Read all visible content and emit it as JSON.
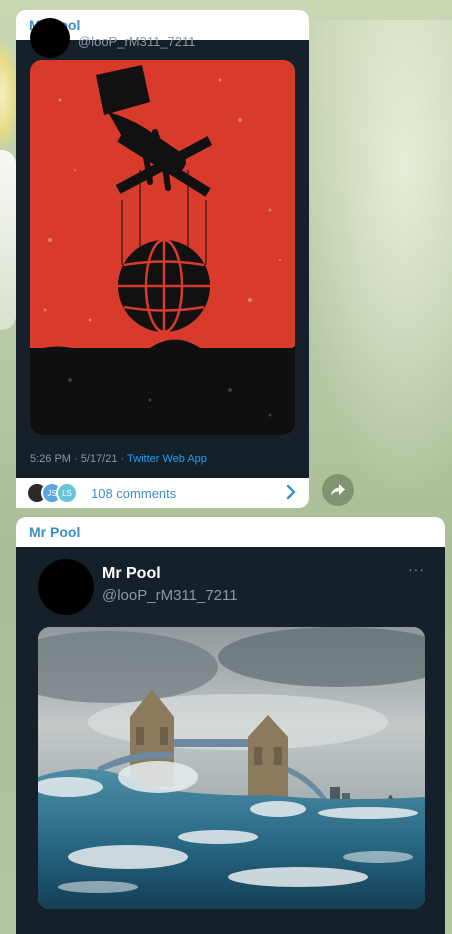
{
  "messages": [
    {
      "sender": "Mr Pool",
      "tweet": {
        "handle": "@looP_rM311_7211",
        "meta_time": "5:26 PM · 5/17/21 · ",
        "meta_app": "Twitter Web App"
      },
      "comments": {
        "avatars": [
          "",
          "JS",
          "LS"
        ],
        "label": "108 comments"
      }
    },
    {
      "sender": "Mr Pool",
      "tweet": {
        "name": "Mr Pool",
        "handle": "@looP_rM311_7211",
        "more": "···"
      }
    }
  ],
  "colors": {
    "sender": "#3a8fc8",
    "tweet_bg": "#15202b",
    "link": "#1da1f2",
    "poster_red": "#d83a2c"
  },
  "icons": [
    "chevron-right-icon",
    "share-arrow-icon",
    "more-icon"
  ]
}
